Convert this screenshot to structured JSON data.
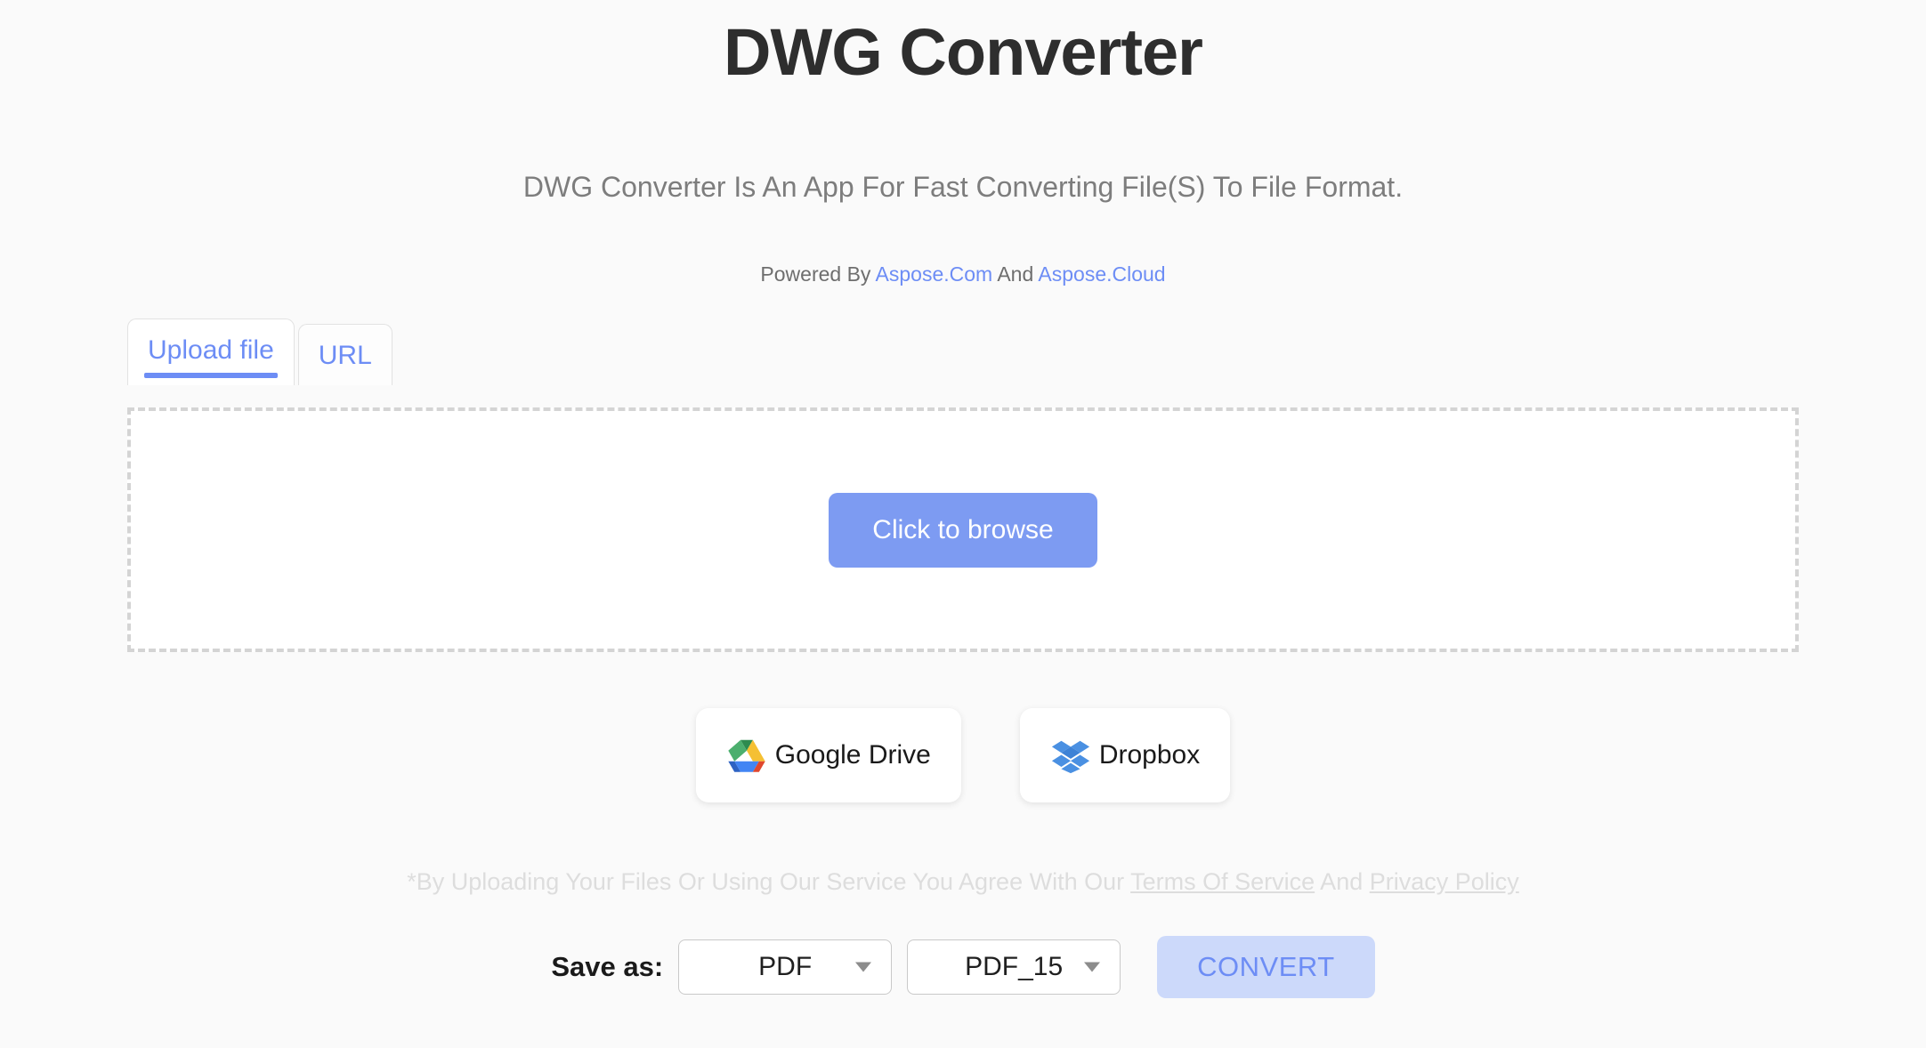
{
  "header": {
    "title": "DWG Converter",
    "subtitle": "DWG Converter Is An App For Fast Converting File(S) To File Format.",
    "powered_prefix": "Powered By ",
    "powered_link1": "Aspose.Com",
    "powered_middle": " And ",
    "powered_link2": "Aspose.Cloud"
  },
  "tabs": [
    {
      "label": "Upload file",
      "active": true
    },
    {
      "label": "URL",
      "active": false
    }
  ],
  "dropzone": {
    "browse_label": "Click to browse"
  },
  "cloud_buttons": [
    {
      "label": "Google Drive",
      "icon": "google-drive-icon"
    },
    {
      "label": "Dropbox",
      "icon": "dropbox-icon"
    }
  ],
  "terms": {
    "prefix": "*By Uploading Your Files Or Using Our Service You Agree With Our ",
    "link1": "Terms Of Service",
    "middle": " And ",
    "link2": "Privacy Policy"
  },
  "save_as": {
    "label": "Save as:",
    "format_value": "PDF",
    "version_value": "PDF_15",
    "convert_label": "CONVERT"
  },
  "colors": {
    "accent_blue": "#6d8df5",
    "button_blue": "#7d9bf2",
    "convert_bg": "#ccd9fa",
    "page_bg": "#fafafa",
    "title_gray": "#2e2e2e",
    "subtitle_gray": "#7d7d7d",
    "terms_gray": "#dddddd"
  }
}
